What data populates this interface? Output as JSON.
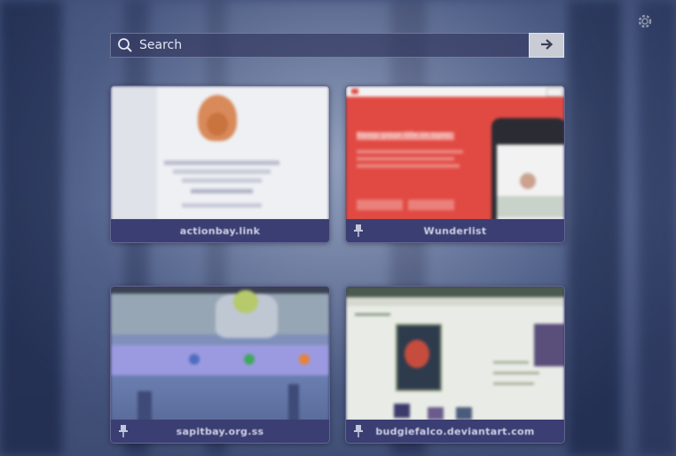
{
  "search": {
    "placeholder": "Search"
  },
  "tiles": [
    {
      "label": "actionbay.link",
      "pinned": false
    },
    {
      "label": "Wunderlist",
      "pinned": true,
      "page_heading": "Keep your life in sync"
    },
    {
      "label": "sapitbay.org.ss",
      "pinned": true
    },
    {
      "label": "budgiefalco.deviantart.com",
      "pinned": true
    }
  ],
  "icons": [
    "search-icon",
    "arrow-right-icon",
    "settings-icon",
    "pin-icon"
  ],
  "colors": {
    "tile_bar": "#3b3e72",
    "search_bg": "#343a62",
    "wunderlist_red": "#e14a42"
  }
}
